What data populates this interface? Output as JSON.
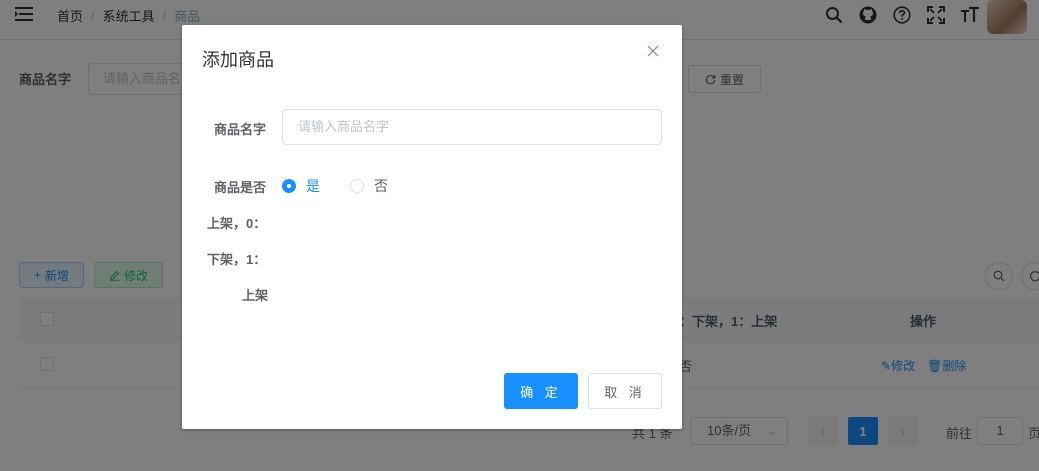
{
  "navbar": {
    "breadcrumb": [
      "首页",
      "系统工具",
      "商品"
    ],
    "icons": [
      "search-icon",
      "github-icon",
      "question-icon",
      "fullscreen-icon",
      "font-size-icon"
    ]
  },
  "search": {
    "label": "商品名字",
    "placeholder": "请输入商品名",
    "reset_label": "重置"
  },
  "toolbar": {
    "add_label": "新增",
    "edit_label": "修改"
  },
  "table": {
    "header_status": "：下架，1：上架",
    "header_ops": "操作",
    "rows": [
      {
        "status": "否",
        "edit": "修改",
        "delete": "删除"
      }
    ]
  },
  "pagination": {
    "total": "共 1 条",
    "page_size": "10条/页",
    "current_page": "1",
    "goto_label": "前往",
    "goto_value": "1",
    "page_suffix": "页"
  },
  "dialog": {
    "title": "添加商品",
    "name_label": "商品名字",
    "name_placeholder": "请输入商品名字",
    "status_label": "商品是否",
    "status_line2": "上架，0：",
    "status_line3": "下架，1：",
    "status_line4": "上架",
    "options": [
      "是",
      "否"
    ],
    "selected": "是",
    "confirm_label": "确 定",
    "cancel_label": "取 消"
  },
  "colors": {
    "primary": "#1890ff",
    "success": "#13ce66",
    "overlay": "rgba(0,0,0,0.5)"
  }
}
